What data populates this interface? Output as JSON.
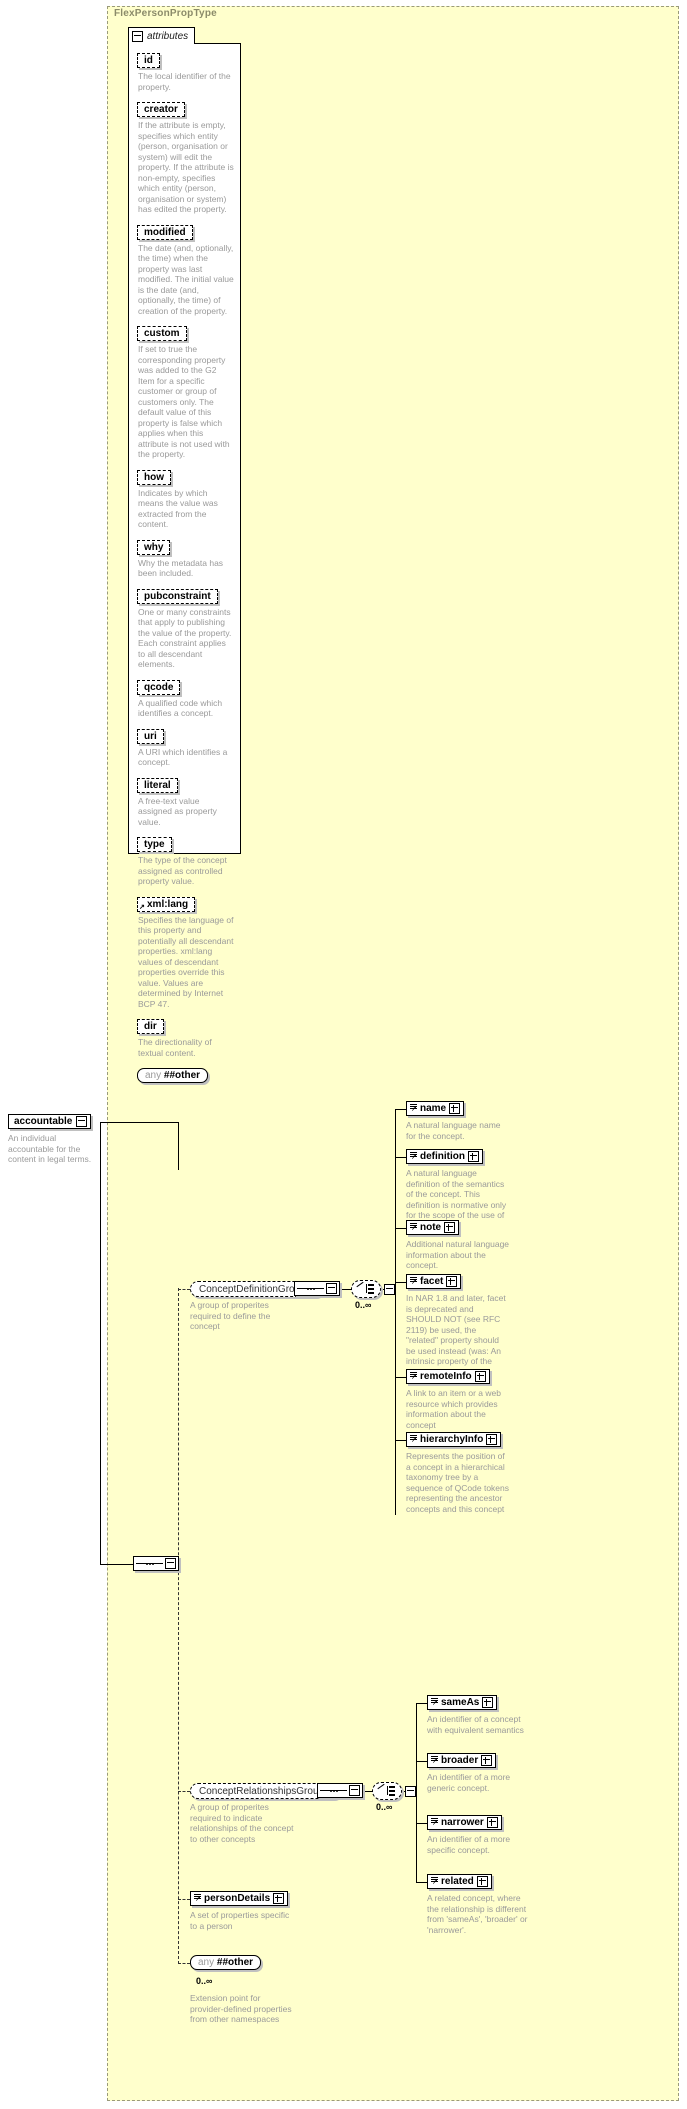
{
  "complex_type": {
    "title": "FlexPersonPropType"
  },
  "attributes_section": {
    "label": "attributes",
    "toggle": "minus",
    "items": [
      {
        "name": "id",
        "doc": "The local identifier of the property."
      },
      {
        "name": "creator",
        "doc": "If the attribute is empty, specifies which entity (person, organisation or system) will edit the property. If the attribute is non-empty, specifies which entity (person, organisation or system) has edited the property."
      },
      {
        "name": "modified",
        "doc": "The date (and, optionally, the time) when the property was last modified. The initial value is the date (and, optionally, the time) of creation of the property."
      },
      {
        "name": "custom",
        "doc": "If set to true the corresponding property was added to the G2 Item for a specific customer or group of customers only. The default value of this property is false which applies when this attribute is not used with the property."
      },
      {
        "name": "how",
        "doc": "Indicates by which means the value was extracted from the content."
      },
      {
        "name": "why",
        "doc": "Why the metadata has been included."
      },
      {
        "name": "pubconstraint",
        "doc": "One or many constraints that apply to publishing the value of the property. Each constraint applies to all descendant elements."
      },
      {
        "name": "qcode",
        "doc": "A qualified code which identifies a concept."
      },
      {
        "name": "uri",
        "doc": "A URI which identifies a concept."
      },
      {
        "name": "literal",
        "doc": "A free-text value assigned as property value."
      },
      {
        "name": "type",
        "doc": "The type of the concept assigned as controlled property value."
      },
      {
        "name": "xml:lang",
        "doc": "Specifies the language of this property and potentially all descendant properties. xml:lang values of descendant properties override this value. Values are determined by Internet BCP 47."
      },
      {
        "name": "dir",
        "doc": "The directionality of textual content."
      }
    ],
    "any": {
      "keyword": "any",
      "namespace": "##other"
    }
  },
  "root_element": {
    "name": "accountable",
    "doc": "An individual accountable for the content in legal terms.",
    "toggle": "minus"
  },
  "groups": {
    "concept_definition": {
      "name": "ConceptDefinitionGroup",
      "doc": "A group of properites required to define the concept",
      "cardinality": "0..∞",
      "children": [
        {
          "name": "name",
          "doc": "A natural language name for the concept."
        },
        {
          "name": "definition",
          "doc": "A natural language definition of the semantics of the concept. This definition is normative only for the scope of the use of this concept."
        },
        {
          "name": "note",
          "doc": "Additional natural language information about the concept."
        },
        {
          "name": "facet",
          "doc": "In NAR 1.8 and later, facet is deprecated and SHOULD NOT (see RFC 2119) be used, the \"related\" property should be used instead (was: An intrinsic property of the concept.)"
        },
        {
          "name": "remoteInfo",
          "doc": "A link to an item or a web resource which provides information about the concept"
        },
        {
          "name": "hierarchyInfo",
          "doc": "Represents the position of a concept in a hierarchical taxonomy tree by a sequence of QCode tokens representing the ancestor concepts and this concept"
        }
      ]
    },
    "concept_relationships": {
      "name": "ConceptRelationshipsGroup",
      "doc": "A group of properites required to indicate relationships of the concept to other concepts",
      "cardinality": "0..∞",
      "children": [
        {
          "name": "sameAs",
          "doc": "An identifier of a concept with equivalent semantics"
        },
        {
          "name": "broader",
          "doc": "An identifier of a more generic concept."
        },
        {
          "name": "narrower",
          "doc": "An identifier of a more specific concept."
        },
        {
          "name": "related",
          "doc": "A related concept, where the relationship is different from 'sameAs', 'broader' or 'narrower'."
        }
      ]
    }
  },
  "tail_elements": [
    {
      "name": "personDetails",
      "doc": "A set of properties specific to a person"
    }
  ],
  "tail_any": {
    "keyword": "any",
    "namespace": "##other",
    "cardinality": "0..∞",
    "doc": "Extension point for provider-defined properties from other namespaces"
  },
  "colors": {
    "panel_bg": "#ffffcc",
    "panel_border": "#9a9a7a",
    "doc_text": "#9a9a9a",
    "box_shadow": "#c0c0c0",
    "title_text": "#8b8b6a"
  }
}
